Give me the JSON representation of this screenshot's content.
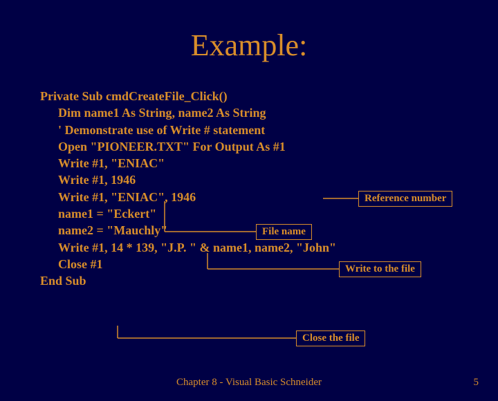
{
  "title": "Example:",
  "code": {
    "l1": "Private Sub cmdCreateFile_Click()",
    "l2": "Dim name1 As String, name2 As String",
    "l3": "' Demonstrate use of Write # statement",
    "l4": "Open \"PIONEER.TXT\" For Output As #1",
    "l5": "Write #1, \"ENIAC\"",
    "l6": "Write #1, 1946",
    "l7": "Write #1, \"ENIAC\", 1946",
    "l8": "name1 = \"Eckert\"",
    "l9": "name2 = \"Mauchly\"",
    "l10": "Write #1, 14 * 139, \"J.P. \" & name1, name2, \"John\"",
    "l11": "Close #1",
    "l12": "End Sub"
  },
  "annotations": {
    "ref_num": "Reference number",
    "file_name": "File name",
    "write_file": "Write to the file",
    "close_file": "Close the file"
  },
  "footer": {
    "center": "Chapter 8 - Visual Basic     Schneider",
    "page": "5"
  }
}
